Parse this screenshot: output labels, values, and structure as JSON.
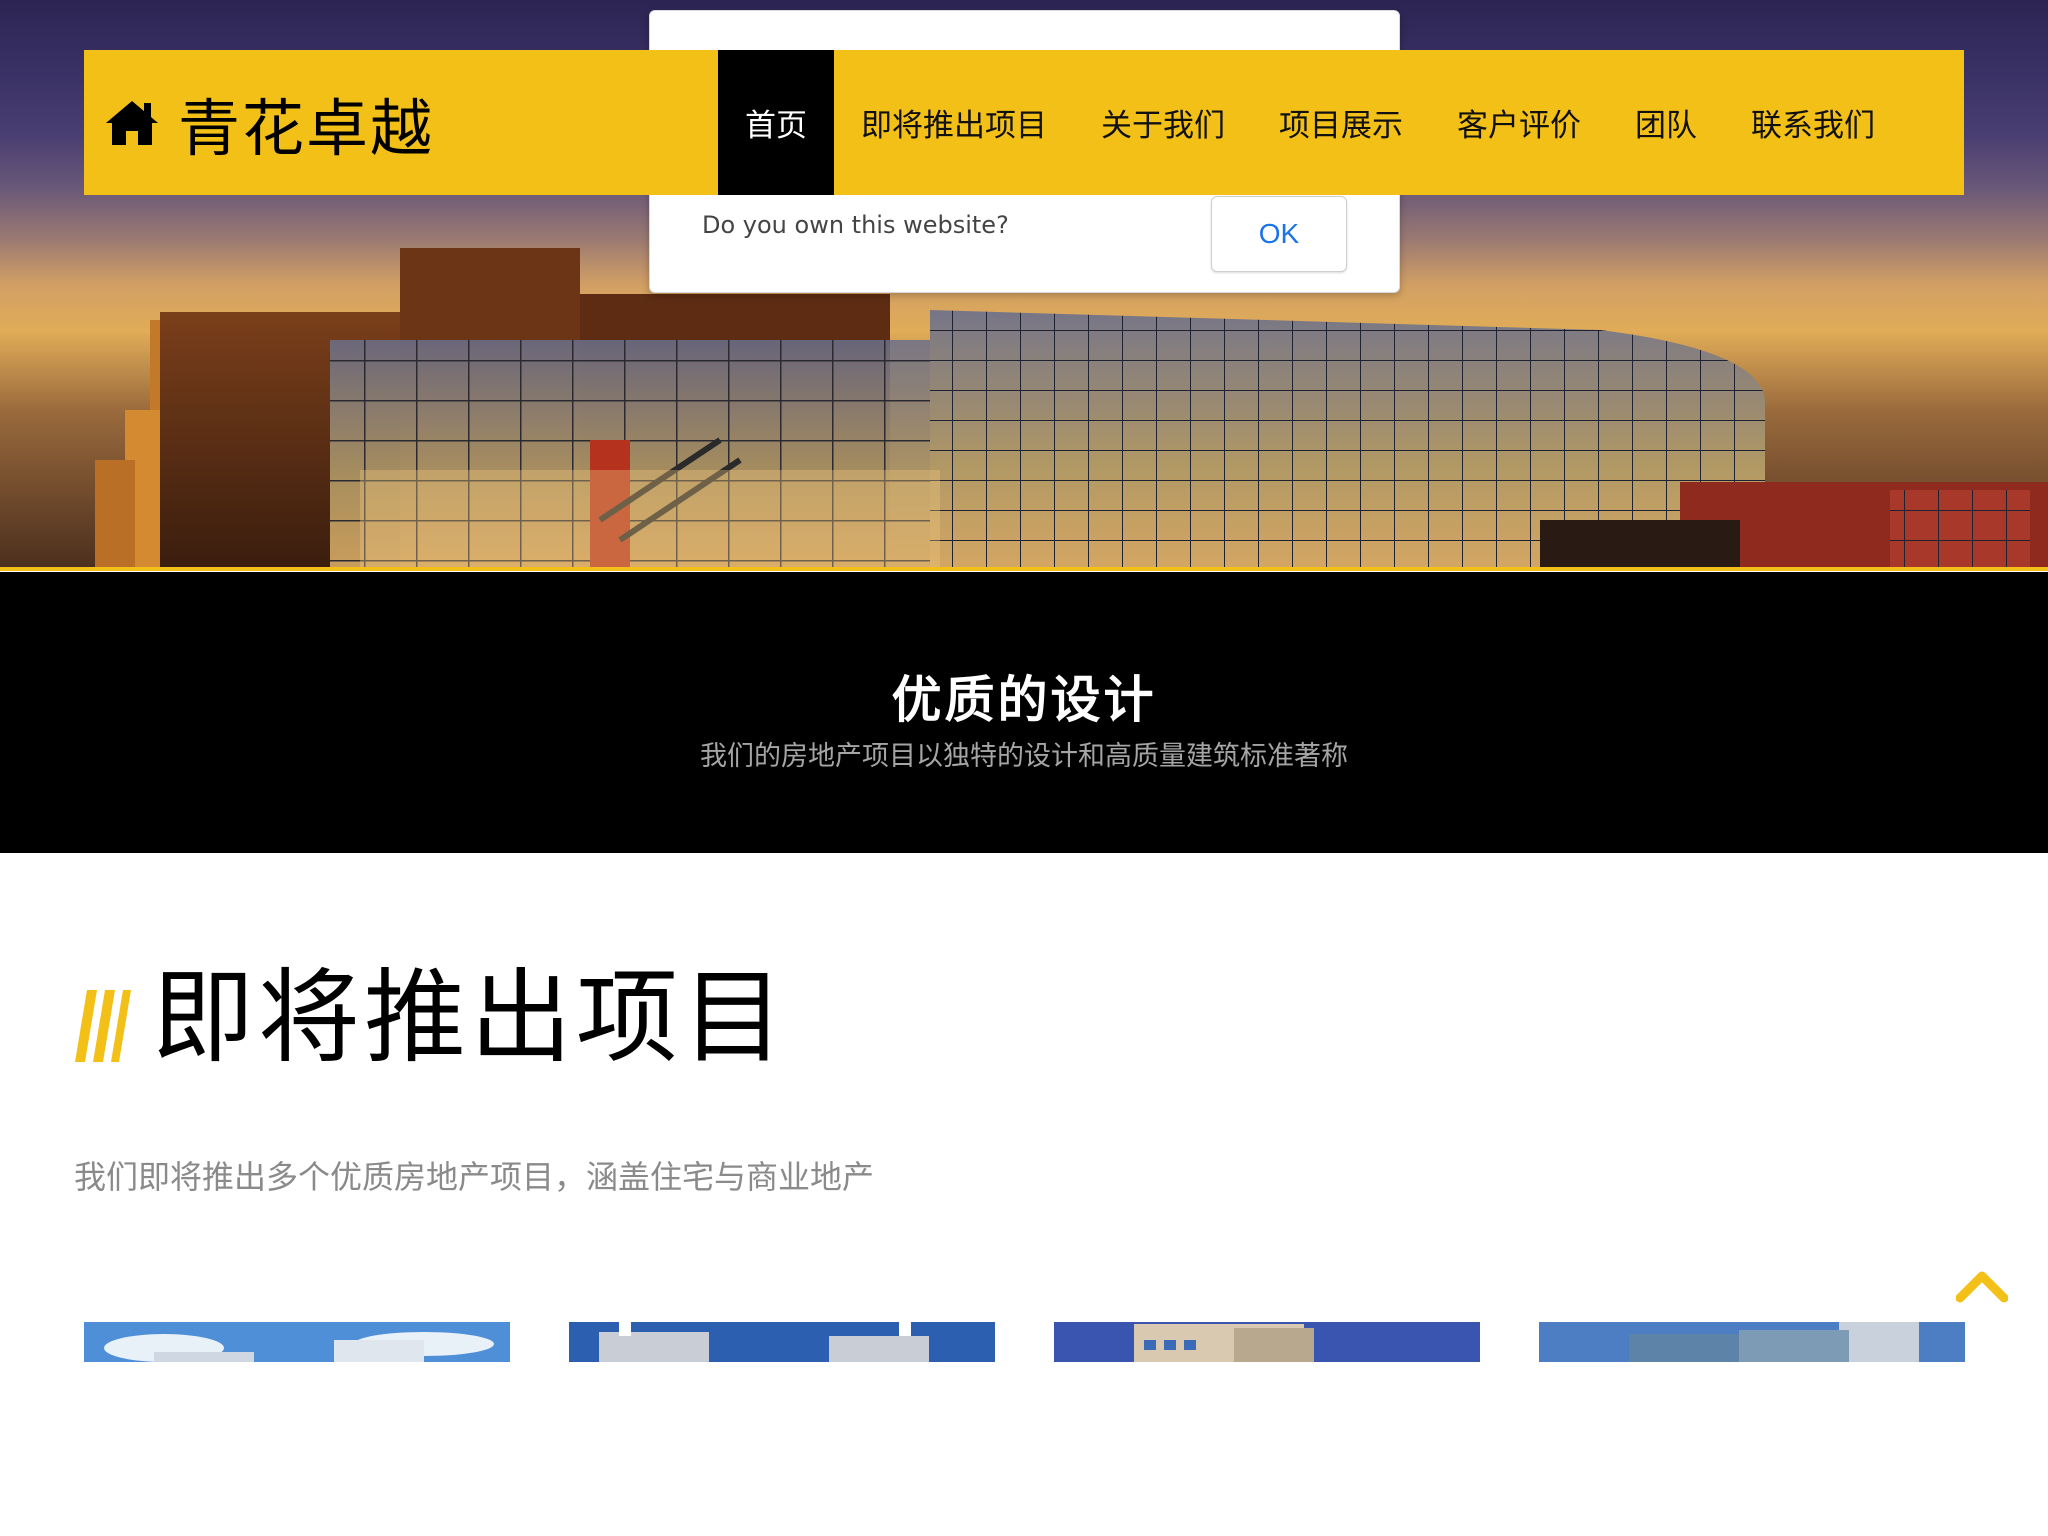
{
  "brand": {
    "name": "青花卓越",
    "icon": "home-icon"
  },
  "nav": {
    "items": [
      {
        "label": "首页",
        "active": true
      },
      {
        "label": "即将推出项目",
        "active": false
      },
      {
        "label": "关于我们",
        "active": false
      },
      {
        "label": "项目展示",
        "active": false
      },
      {
        "label": "客户评价",
        "active": false
      },
      {
        "label": "团队",
        "active": false
      },
      {
        "label": "联系我们",
        "active": false
      }
    ]
  },
  "dialog": {
    "message": "Do you own this website?",
    "ok_label": "OK"
  },
  "banner": {
    "title": "优质的设计",
    "subtitle": "我们的房地产项目以独特的设计和高质量建筑标准著称"
  },
  "section": {
    "title": "即将推出项目",
    "subtitle": "我们即将推出多个优质房地产项目，涵盖住宅与商业地产"
  },
  "colors": {
    "accent": "#f3c017",
    "dark": "#000000",
    "link": "#1a73e8",
    "muted": "#8a8a8a"
  },
  "icons": {
    "back_to_top": "chevron-up-icon",
    "section_mark": "stripes-icon"
  }
}
